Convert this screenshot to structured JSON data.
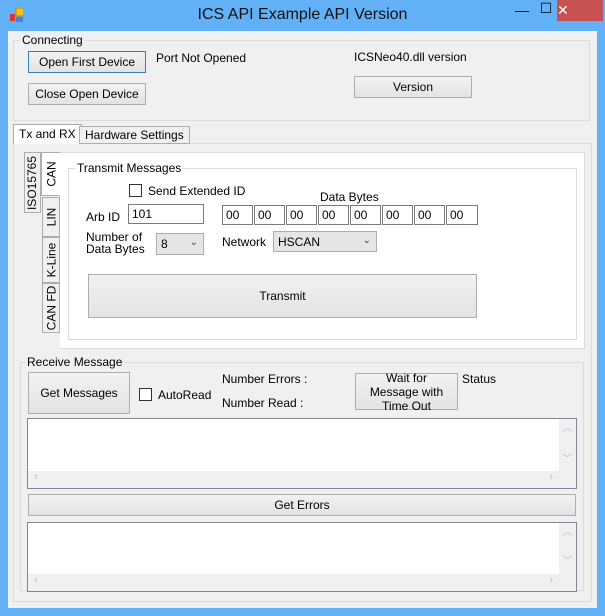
{
  "window": {
    "title": "ICS API Example API Version",
    "icon": "app-icon",
    "minimize": "—",
    "maximize": "☐",
    "close": "✕"
  },
  "connecting": {
    "label": "Connecting",
    "open_first": "Open First Device",
    "close_open": "Close Open Device",
    "port_status": "Port Not Opened",
    "dll_version_label": "ICSNeo40.dll version",
    "version_button": "Version"
  },
  "tabs": [
    {
      "label": "Tx and RX",
      "selected": true
    },
    {
      "label": "Hardware Settings"
    }
  ],
  "vtabs": [
    {
      "label": "ISO15765"
    },
    {
      "label": "CAN",
      "selected": true
    },
    {
      "label": "LIN"
    },
    {
      "label": "K-Line"
    },
    {
      "label": "CAN FD"
    }
  ],
  "transmit": {
    "label": "Transmit Messages",
    "send_extended_id": "Send Extended ID",
    "send_extended_checked": false,
    "data_bytes_label": "Data Bytes",
    "arb_id_label": "Arb ID",
    "arb_id": "101",
    "data_bytes": [
      "00",
      "00",
      "00",
      "00",
      "00",
      "00",
      "00",
      "00"
    ],
    "num_bytes_label": "Number of Data Bytes",
    "num_bytes": "8",
    "network_label": "Network",
    "network": "HSCAN",
    "transmit_button": "Transmit"
  },
  "receive": {
    "label": "Receive Message",
    "get_messages": "Get Messages",
    "autoread": "AutoRead",
    "autoread_checked": false,
    "number_errors": "Number Errors :",
    "number_read": "Number Read :",
    "wait_button": "Wait for Message with Time Out",
    "status": "Status",
    "get_errors": "Get Errors"
  }
}
